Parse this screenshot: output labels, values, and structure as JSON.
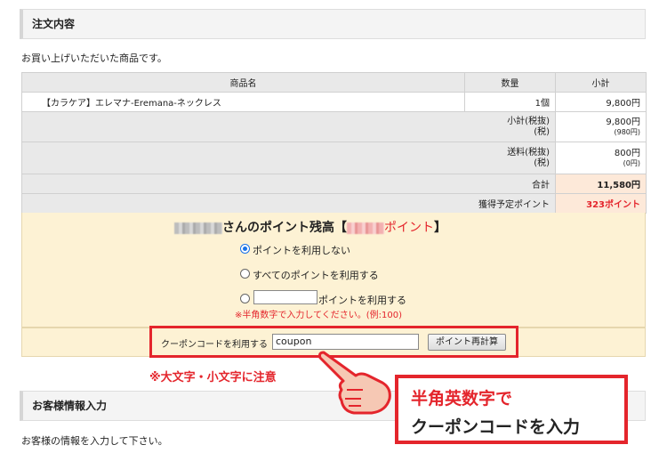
{
  "order_section": {
    "title": "注文内容",
    "intro": "お買い上げいただいた商品です。",
    "table": {
      "headers": [
        "商品名",
        "数量",
        "小計"
      ],
      "item": {
        "name": "【カラケア】エレマナ-Eremana-ネックレス",
        "qty": "1個",
        "price": "9,800円"
      },
      "subtotal": {
        "label": "小計(税抜)",
        "tax_label": "(税)",
        "value": "9,800円",
        "tax": "(980円)"
      },
      "shipping": {
        "label": "送料(税抜)",
        "tax_label": "(税)",
        "value": "800円",
        "tax": "(0円)"
      },
      "total": {
        "label": "合計",
        "value": "11,580円"
      },
      "points": {
        "label": "獲得予定ポイント",
        "value": "323ポイント"
      }
    }
  },
  "points_panel": {
    "balance_suffix": "さんのポイント残高【",
    "balance_unit": "ポイント",
    "balance_close": "】",
    "options": [
      {
        "label": "ポイントを利用しない",
        "selected": true
      },
      {
        "label": "すべてのポイントを利用する",
        "selected": false
      },
      {
        "label": "ポイントを利用する",
        "selected": false
      }
    ],
    "input_note": "※半角数字で入力してください。(例:100)"
  },
  "coupon": {
    "label": "クーポンコードを利用する",
    "value": "coupon",
    "recalc_button": "ポイント再計算"
  },
  "annotations": {
    "case_note": "※大文字・小文字に注意",
    "callout_line1": "半角英数字で",
    "callout_line2": "クーポンコードを入力"
  },
  "customer_section": {
    "title": "お客様情報入力",
    "intro": "お客様の情報を入力して下さい。"
  },
  "colors": {
    "accent_red": "#e4252c",
    "panel_bg": "#fdf2d4",
    "highlight": "#fde9d9"
  }
}
